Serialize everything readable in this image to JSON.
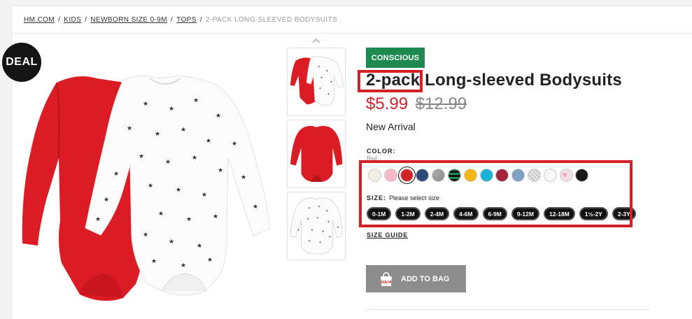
{
  "breadcrumb": {
    "items": [
      "HM.COM",
      "KIDS",
      "NEWBORN SIZE 0-9M",
      "TOPS"
    ],
    "current": "2-PACK LONG-SLEEVED BODYSUITS",
    "separator": "/"
  },
  "deal_badge": "DEAL",
  "product": {
    "badge": "CONSCIOUS",
    "title_highlight": "2-pack",
    "title_rest": " Long-sleeved Bodysuits",
    "price_now": "$5.99",
    "price_was": "$12.99",
    "arrival": "New Arrival"
  },
  "color": {
    "label": "COLOR:",
    "value": "Red",
    "swatches": [
      {
        "name": "off-white",
        "hex": "#f1eee6"
      },
      {
        "name": "light-pink",
        "hex": "#f7b9c6"
      },
      {
        "name": "red",
        "hex": "#d0232a",
        "selected": true
      },
      {
        "name": "dark-blue",
        "hex": "#2c4a78"
      },
      {
        "name": "grey-melange",
        "hex": "#8a8a8a"
      },
      {
        "name": "green-striped",
        "hex": "#1e8a5a"
      },
      {
        "name": "yellow",
        "hex": "#f3b614"
      },
      {
        "name": "turquoise",
        "hex": "#19b3d6"
      },
      {
        "name": "dark-red",
        "hex": "#a3233a"
      },
      {
        "name": "light-blue",
        "hex": "#7fa2c4"
      },
      {
        "name": "light-grey",
        "hex": "#d6d6d6"
      },
      {
        "name": "white",
        "hex": "#f6f6f6"
      },
      {
        "name": "white-heart",
        "hex": "#f3dfe3"
      },
      {
        "name": "black",
        "hex": "#1a1a1a"
      }
    ]
  },
  "size": {
    "label": "SIZE:",
    "hint": "Please select size",
    "options": [
      "0-1M",
      "1-2M",
      "2-4M",
      "4-6M",
      "6-9M",
      "9-12M",
      "12-18M",
      "1½-2Y",
      "2-3Y"
    ]
  },
  "size_guide": "SIZE GUIDE",
  "add_to_bag": "ADD TO BAG",
  "colors": {
    "accent_red": "#d32128",
    "badge_green": "#1f8a4f",
    "button_grey": "#8d8d8d"
  }
}
